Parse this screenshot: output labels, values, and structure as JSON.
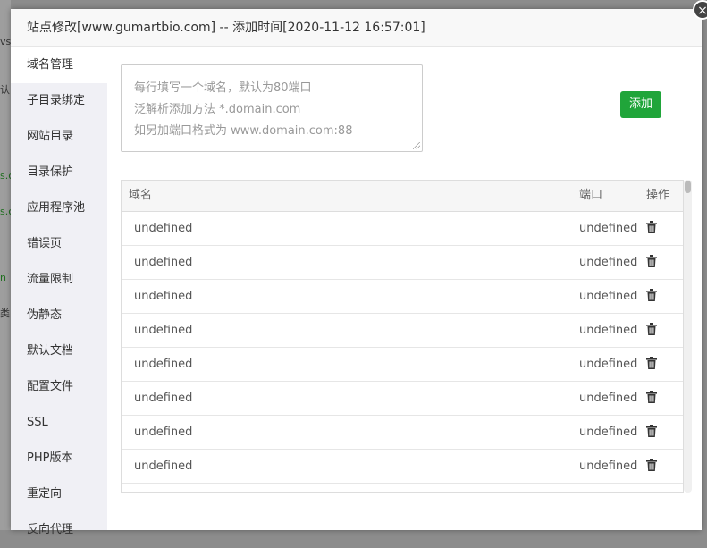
{
  "dialog": {
    "title": "站点修改[www.gumartbio.com] -- 添加时间[2020-11-12 16:57:01]",
    "close_label": "×"
  },
  "backdrop": {
    "fragments": [
      "vs",
      "认",
      "s.c",
      "s.c",
      "n",
      "类"
    ]
  },
  "sidebar": {
    "items": [
      {
        "label": "域名管理",
        "active": true
      },
      {
        "label": "子目录绑定"
      },
      {
        "label": "网站目录"
      },
      {
        "label": "目录保护"
      },
      {
        "label": "应用程序池"
      },
      {
        "label": "错误页"
      },
      {
        "label": "流量限制"
      },
      {
        "label": "伪静态"
      },
      {
        "label": "默认文档"
      },
      {
        "label": "配置文件"
      },
      {
        "label": "SSL"
      },
      {
        "label": "PHP版本"
      },
      {
        "label": "重定向"
      },
      {
        "label": "反向代理"
      }
    ]
  },
  "domain_form": {
    "placeholder_lines": [
      "每行填写一个域名，默认为80端口",
      "泛解析添加方法 *.domain.com",
      "如另加端口格式为 www.domain.com:88"
    ],
    "add_label": "添加"
  },
  "table": {
    "headers": {
      "domain": "域名",
      "port": "端口",
      "action": "操作"
    },
    "rows": [
      {
        "domain": "undefined",
        "port": "undefined"
      },
      {
        "domain": "undefined",
        "port": "undefined"
      },
      {
        "domain": "undefined",
        "port": "undefined"
      },
      {
        "domain": "undefined",
        "port": "undefined"
      },
      {
        "domain": "undefined",
        "port": "undefined"
      },
      {
        "domain": "undefined",
        "port": "undefined"
      },
      {
        "domain": "undefined",
        "port": "undefined"
      },
      {
        "domain": "undefined",
        "port": "undefined"
      }
    ]
  }
}
